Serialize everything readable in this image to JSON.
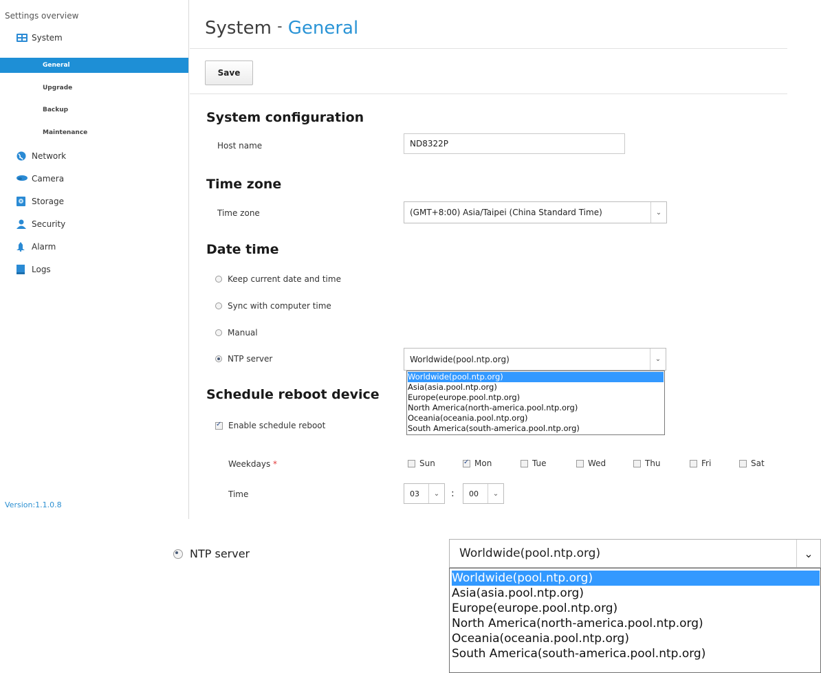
{
  "sidebar": {
    "title": "Settings overview",
    "items": [
      {
        "label": "System",
        "icon": "system-icon",
        "color": "#2a8ad4"
      },
      {
        "label": "Network",
        "icon": "globe-icon",
        "color": "#2a8ad4"
      },
      {
        "label": "Camera",
        "icon": "camera-icon",
        "color": "#2a8ad4"
      },
      {
        "label": "Storage",
        "icon": "storage-icon",
        "color": "#2a8ad4"
      },
      {
        "label": "Security",
        "icon": "user-icon",
        "color": "#2a8ad4"
      },
      {
        "label": "Alarm",
        "icon": "alarm-icon",
        "color": "#2a8ad4"
      },
      {
        "label": "Logs",
        "icon": "logs-icon",
        "color": "#2a8ad4"
      }
    ],
    "sub_items": [
      "General",
      "Upgrade",
      "Backup",
      "Maintenance"
    ],
    "active_sub": "General",
    "version": "Version:1.1.0.8"
  },
  "header": {
    "title_main": "System",
    "title_sep": "-",
    "title_accent": "General",
    "accent_color": "#2a94d6"
  },
  "toolbar": {
    "save_label": "Save"
  },
  "system_config": {
    "heading": "System configuration",
    "host_label": "Host name",
    "host_value": "ND8322P"
  },
  "time_zone": {
    "heading": "Time zone",
    "label": "Time zone",
    "value": "(GMT+8:00) Asia/Taipei (China Standard Time)"
  },
  "date_time": {
    "heading": "Date time",
    "options": [
      "Keep current date and time",
      "Sync with computer time",
      "Manual",
      "NTP server"
    ],
    "selected": "NTP server",
    "ntp_value": "Worldwide(pool.ntp.org)",
    "ntp_options": [
      "Worldwide(pool.ntp.org)",
      "Asia(asia.pool.ntp.org)",
      "Europe(europe.pool.ntp.org)",
      "North America(north-america.pool.ntp.org)",
      "Oceania(oceania.pool.ntp.org)",
      "South America(south-america.pool.ntp.org)"
    ]
  },
  "reboot": {
    "heading": "Schedule reboot device",
    "enable_label": "Enable schedule reboot",
    "enabled": true,
    "weekdays_label": "Weekdays",
    "required_mark": "*",
    "days": [
      {
        "label": "Sun",
        "checked": false
      },
      {
        "label": "Mon",
        "checked": true
      },
      {
        "label": "Tue",
        "checked": false
      },
      {
        "label": "Wed",
        "checked": false
      },
      {
        "label": "Thu",
        "checked": false
      },
      {
        "label": "Fri",
        "checked": false
      },
      {
        "label": "Sat",
        "checked": false
      }
    ],
    "time_label": "Time",
    "hour": "03",
    "minute": "00",
    "separator": ":"
  },
  "zoom": {
    "radio_label": "NTP server",
    "value": "Worldwide(pool.ntp.org)"
  }
}
